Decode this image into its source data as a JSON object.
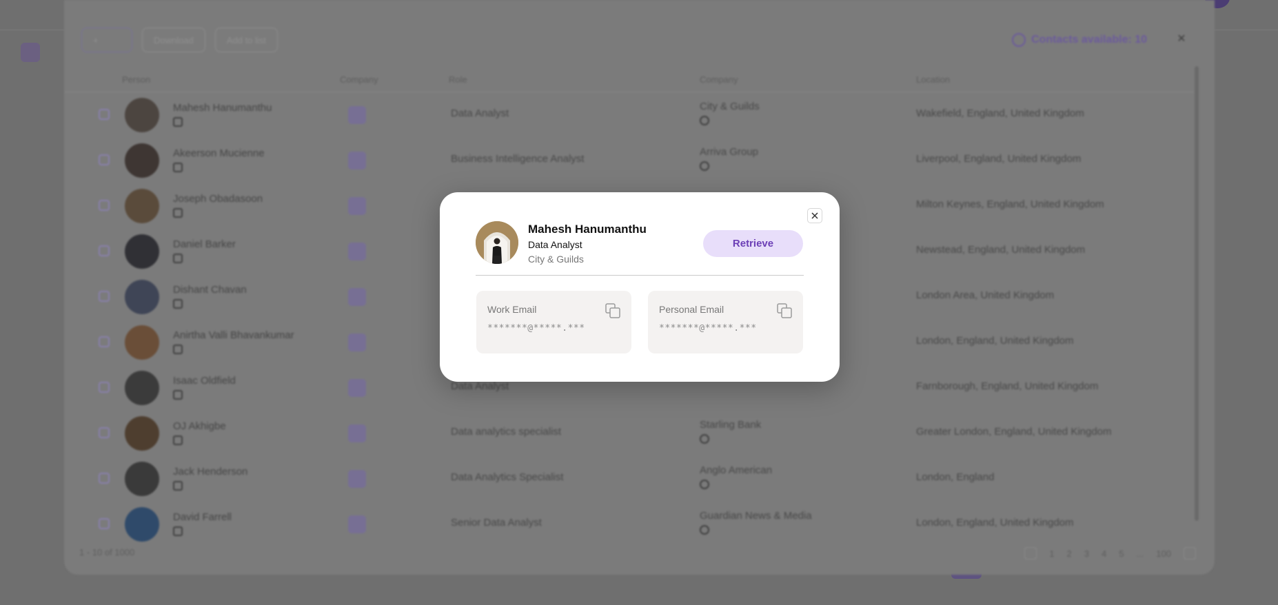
{
  "background": {
    "toolbar": {
      "select_label": "+",
      "download_label": "Download",
      "add_to_list_label": "Add to list"
    },
    "contacts_available": "Contacts available: 10",
    "columns": [
      "Person",
      "Company",
      "Role",
      "Company",
      "Location"
    ],
    "rows": [
      {
        "name": "Mahesh Hanumanthu",
        "role": "Data Analyst",
        "company": "City & Guilds",
        "location": "Wakefield, England, United Kingdom",
        "avatar_color": "#4c4540"
      },
      {
        "name": "Akeerson Mucienne",
        "role": "Business Intelligence Analyst",
        "company": "Arriva Group",
        "location": "Liverpool, England, United Kingdom",
        "avatar_color": "#3e3633"
      },
      {
        "name": "Joseph Obadasoon",
        "role": "",
        "company": "",
        "location": "Milton Keynes, England, United Kingdom",
        "avatar_color": "#5a4b3b"
      },
      {
        "name": "Daniel Barker",
        "role": "",
        "company": "",
        "location": "Newstead, England, United Kingdom",
        "avatar_color": "#303035"
      },
      {
        "name": "Dishant Chavan",
        "role": "",
        "company": "",
        "location": "London Area, United Kingdom",
        "avatar_color": "#3f4556"
      },
      {
        "name": "Anirtha Valli Bhavankumar",
        "role": "",
        "company": "",
        "location": "London, England, United Kingdom",
        "avatar_color": "#6a4e38"
      },
      {
        "name": "Isaac Oldfield",
        "role": "Data Analyst",
        "company": "",
        "location": "Farnborough, England, United Kingdom",
        "avatar_color": "#3b3b3b"
      },
      {
        "name": "OJ Akhigbe",
        "role": "Data analytics specialist",
        "company": "Starling Bank",
        "location": "Greater London, England, United Kingdom",
        "avatar_color": "#4e3e2f"
      },
      {
        "name": "Jack Henderson",
        "role": "Data Analytics Specialist",
        "company": "Anglo American",
        "location": "London, England",
        "avatar_color": "#3a3a3a"
      },
      {
        "name": "David Farrell",
        "role": "Senior Data Analyst",
        "company": "Guardian News & Media",
        "location": "London, England, United Kingdom",
        "avatar_color": "#2f4a6a"
      }
    ],
    "footer": {
      "count_text": "1 - 10 of 1000",
      "pages": [
        "1",
        "2",
        "3",
        "4",
        "5",
        "...",
        "100"
      ]
    }
  },
  "modal": {
    "name": "Mahesh Hanumanthu",
    "role": "Data Analyst",
    "company": "City & Guilds",
    "retrieve_label": "Retrieve",
    "work_email_label": "Work Email",
    "work_email_value": "*******@*****.***",
    "personal_email_label": "Personal Email",
    "personal_email_value": "*******@*****.***",
    "accent_color": "#6c3fb6",
    "retrieve_bg": "#e8defa"
  }
}
